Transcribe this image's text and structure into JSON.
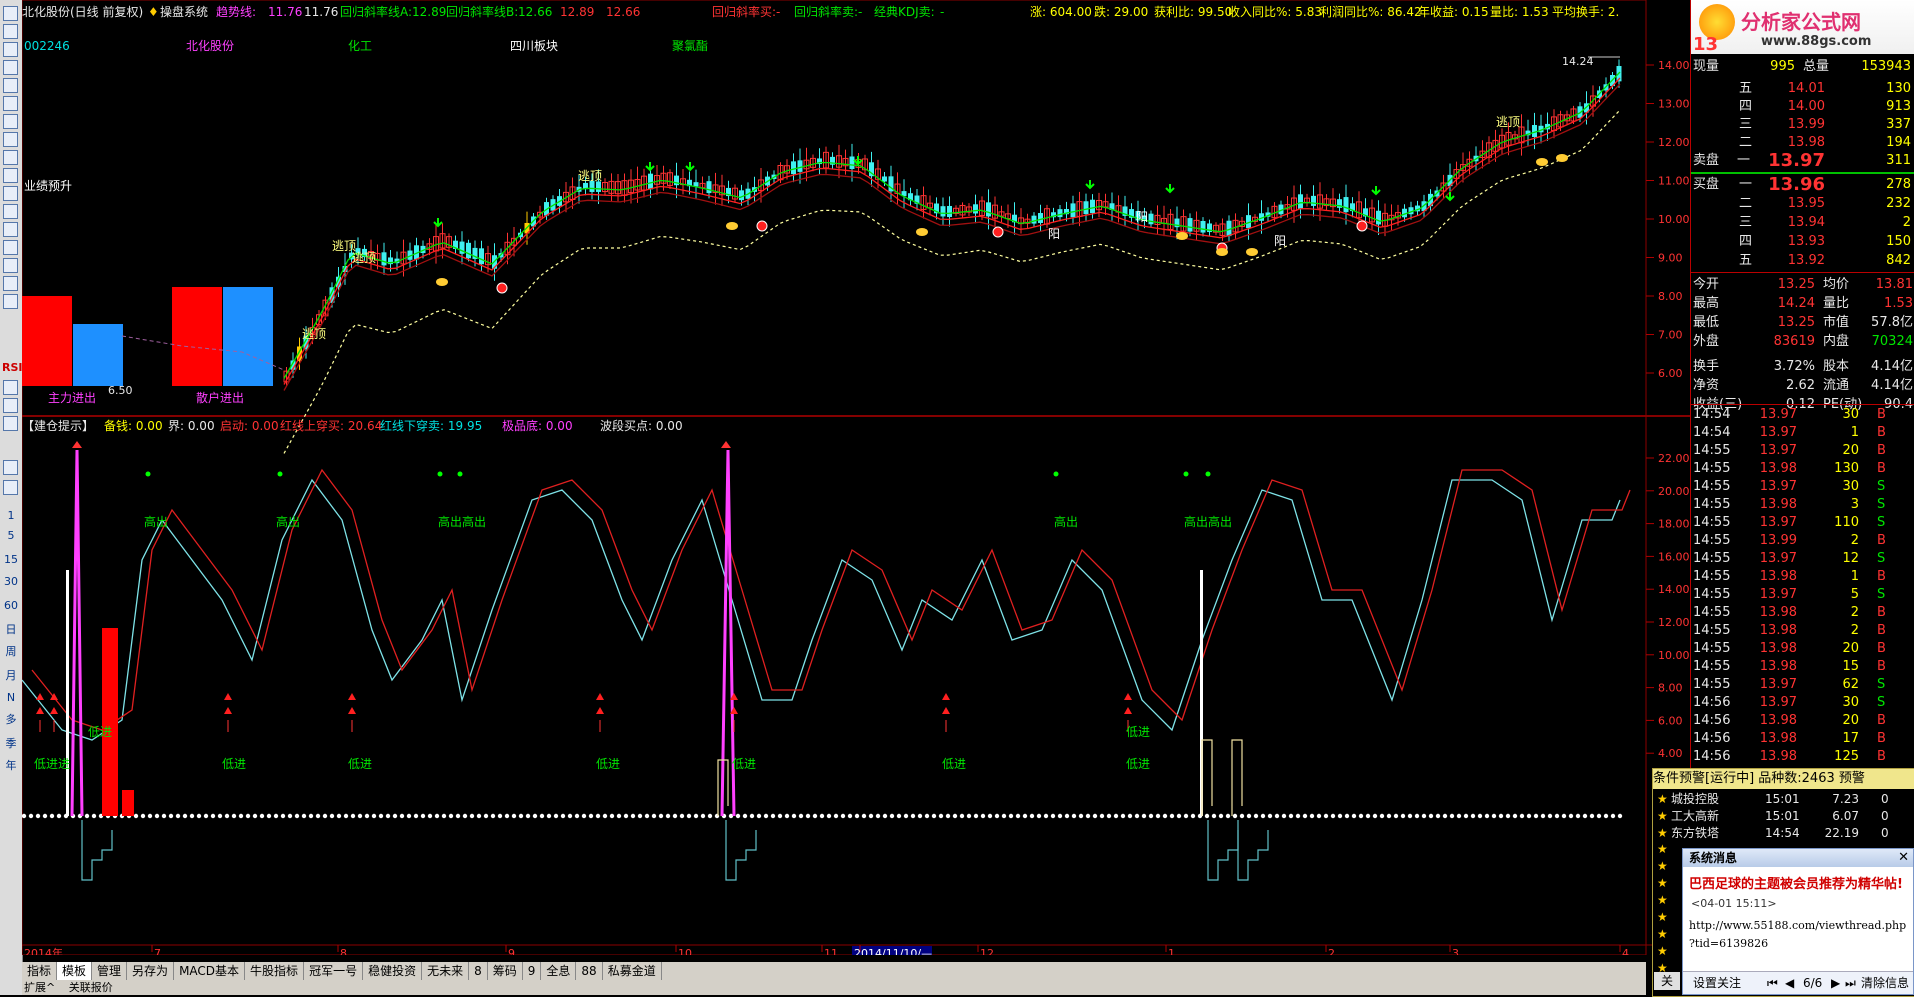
{
  "window": {
    "title": "北化股份(日线 前复权)",
    "system_name": "操盘系统",
    "trend_label": "趋势线:",
    "trend_value": "11.76",
    "trend_value2": "11.76",
    "lineA_label": "回归斜率线A:",
    "lineA_value": "12.89",
    "lineB_label": "回归斜率线B:",
    "lineB_value": "12.66",
    "lineB_v2": "12.89",
    "lineB_v3": "12.66",
    "buy_sig": "回归斜率买:",
    "buy_sig_v": "-",
    "sell_sig": "回归斜率卖:",
    "sell_sig_v": "-",
    "kdj_sig": "经典KDJ卖:",
    "kdj_sig_v": "-"
  },
  "stats_line": {
    "up": "涨: 604.00",
    "down": "跌: 29.00",
    "profit_ratio": "获利比: 99.50",
    "income_yoy": "收入同比%: 5.83",
    "profit_yoy": "利润同比%: 86.42",
    "eps": "年收益: 0.15",
    "vol_ratio": "量比: 1.53",
    "avg_turnover": "平均换手: 2."
  },
  "stock_info": {
    "code": "002246",
    "name": "北化股份",
    "industry": "化工",
    "region": "四川板块",
    "concept": "聚氯酯"
  },
  "chart_labels": {
    "perf_forecast": "业绩预升",
    "main_force": "主力进出",
    "retail": "散户进出",
    "escape_top": "逃顶",
    "yang": "阳",
    "high_price": "14.24",
    "low_price": "6.50",
    "sell_high": "高出",
    "sell_high_double": "高出高出",
    "buy_low": "低进",
    "buy_low_double": "低进进"
  },
  "indicator_line": {
    "title": "【建仓提示】",
    "prep": "备钱: 0.00",
    "bound": "界: 0.00",
    "start": "启动: 0.00",
    "red_up": "红线上穿买: 20.64",
    "red_down": "红线下穿卖: 19.95",
    "extreme_low": "极品底: 0.00",
    "wave_buy": "波段买点: 0.00"
  },
  "price_axis": [
    "14.00",
    "13.00",
    "12.00",
    "11.00",
    "10.00",
    "9.00",
    "8.00",
    "7.00",
    "6.00"
  ],
  "ind_axis": [
    "22.00",
    "20.00",
    "18.00",
    "16.00",
    "14.00",
    "12.00",
    "10.00",
    "8.00",
    "6.00",
    "4.00"
  ],
  "time_axis": [
    "2014年",
    "7",
    "8",
    "9",
    "10",
    "11",
    "2014/11/10/—",
    "12",
    "1",
    "2",
    "3",
    "4"
  ],
  "bottom_tabs": [
    "指标",
    "模板",
    "管理",
    "另存为",
    "MACD基本",
    "牛股指标",
    "冠军一号",
    "稳健投资",
    "无未来",
    "8",
    "筹码",
    "9",
    "全息",
    "88",
    "私募金道"
  ],
  "status_bar": [
    "扩展^",
    "关联报价"
  ],
  "left_toolbar": [
    "RSI",
    "1",
    "5",
    "15",
    "30",
    "60",
    "日",
    "周",
    "月",
    "N",
    "多",
    "季",
    "年"
  ],
  "logo": {
    "title": "分析家公式网",
    "url": "www.88gs.com"
  },
  "quote": {
    "code_partial": "13",
    "now_vol_label": "现量",
    "now_vol": "995",
    "total_vol_label": "总量",
    "total_vol": "153943",
    "sells": [
      {
        "label": "五",
        "price": "14.01",
        "vol": "130"
      },
      {
        "label": "四",
        "price": "14.00",
        "vol": "913"
      },
      {
        "label": "三",
        "price": "13.99",
        "vol": "337"
      },
      {
        "label": "二",
        "price": "13.98",
        "vol": "194"
      },
      {
        "label": "一",
        "price": "13.97",
        "vol": "311"
      }
    ],
    "sell_label": "卖盘",
    "buy_label": "买盘",
    "buys": [
      {
        "label": "一",
        "price": "13.96",
        "vol": "278"
      },
      {
        "label": "二",
        "price": "13.95",
        "vol": "232"
      },
      {
        "label": "三",
        "price": "13.94",
        "vol": "2"
      },
      {
        "label": "四",
        "price": "13.93",
        "vol": "150"
      },
      {
        "label": "五",
        "price": "13.92",
        "vol": "842"
      }
    ],
    "fields": [
      {
        "k1": "今开",
        "v1": "13.25",
        "k2": "均价",
        "v2": "13.81"
      },
      {
        "k1": "最高",
        "v1": "14.24",
        "k2": "量比",
        "v2": "1.53"
      },
      {
        "k1": "最低",
        "v1": "13.25",
        "k2": "市值",
        "v2": "57.8亿"
      },
      {
        "k1": "外盘",
        "v1": "83619",
        "k2": "内盘",
        "v2": "70324"
      },
      {
        "k1": "换手",
        "v1": "3.72%",
        "k2": "股本",
        "v2": "4.14亿"
      },
      {
        "k1": "净资",
        "v1": "2.62",
        "k2": "流通",
        "v2": "4.14亿"
      },
      {
        "k1": "收益(三)",
        "v1": "0.12",
        "k2": "PE(动)",
        "v2": "90.4"
      }
    ],
    "ticks": [
      {
        "t": "14:54",
        "p": "13.97",
        "v": "30",
        "s": "B"
      },
      {
        "t": "14:54",
        "p": "13.97",
        "v": "1",
        "s": "B"
      },
      {
        "t": "14:55",
        "p": "13.97",
        "v": "20",
        "s": "B"
      },
      {
        "t": "14:55",
        "p": "13.98",
        "v": "130",
        "s": "B"
      },
      {
        "t": "14:55",
        "p": "13.97",
        "v": "30",
        "s": "S"
      },
      {
        "t": "14:55",
        "p": "13.98",
        "v": "3",
        "s": "S"
      },
      {
        "t": "14:55",
        "p": "13.97",
        "v": "110",
        "s": "S"
      },
      {
        "t": "14:55",
        "p": "13.99",
        "v": "2",
        "s": "B"
      },
      {
        "t": "14:55",
        "p": "13.97",
        "v": "12",
        "s": "S"
      },
      {
        "t": "14:55",
        "p": "13.98",
        "v": "1",
        "s": "B"
      },
      {
        "t": "14:55",
        "p": "13.97",
        "v": "5",
        "s": "S"
      },
      {
        "t": "14:55",
        "p": "13.98",
        "v": "2",
        "s": "B"
      },
      {
        "t": "14:55",
        "p": "13.98",
        "v": "2",
        "s": "B"
      },
      {
        "t": "14:55",
        "p": "13.98",
        "v": "20",
        "s": "B"
      },
      {
        "t": "14:55",
        "p": "13.98",
        "v": "15",
        "s": "B"
      },
      {
        "t": "14:55",
        "p": "13.97",
        "v": "62",
        "s": "S"
      },
      {
        "t": "14:56",
        "p": "13.97",
        "v": "30",
        "s": "S"
      },
      {
        "t": "14:56",
        "p": "13.98",
        "v": "20",
        "s": "B"
      },
      {
        "t": "14:56",
        "p": "13.98",
        "v": "17",
        "s": "B"
      },
      {
        "t": "14:56",
        "p": "13.98",
        "v": "125",
        "s": "B"
      }
    ]
  },
  "alert": {
    "header": "条件预警[运行中] 品种数:2463 预警",
    "rows": [
      {
        "name": "城投控股",
        "time": "15:01",
        "price": "7.23",
        "chg": "0"
      },
      {
        "name": "工大高新",
        "time": "15:01",
        "price": "6.07",
        "chg": "0"
      },
      {
        "name": "东方铁塔",
        "time": "14:54",
        "price": "22.19",
        "chg": "0"
      }
    ]
  },
  "sys_msg": {
    "title": "系统消息",
    "headline": "巴西足球的主题被会员推荐为精华帖!",
    "date": "<04-01 15:11>",
    "link1": "http://www.55188.com/viewthread.php",
    "link2": "?tid=6139826",
    "settings": "设置关注",
    "page": "6/6",
    "clear": "清除信息",
    "close_partial": "关"
  },
  "colors": {
    "up": "#ff3333",
    "down": "#00e0e0",
    "grid": "#8b0000",
    "kdj_k": "#7ee3e8",
    "kdj_d": "#e02020"
  }
}
